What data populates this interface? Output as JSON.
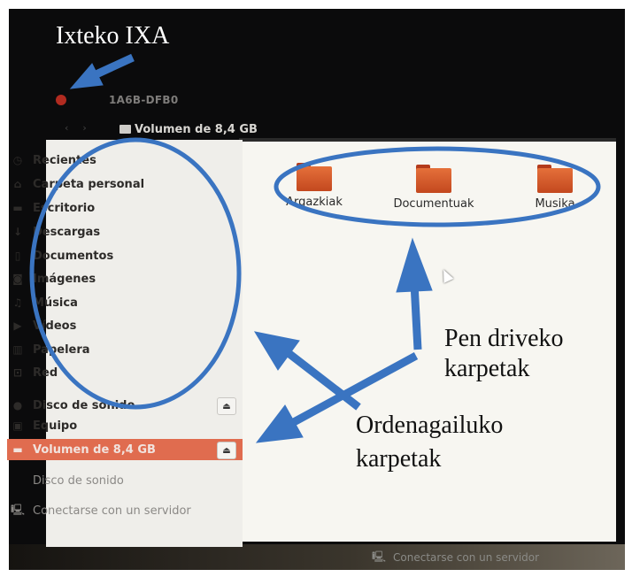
{
  "annotations": {
    "close_hint": "Ixteko IXA",
    "pendrive_label_1": "Pen driveko",
    "pendrive_label_2": "karpetak",
    "computer_label_1": "Ordenagailuko",
    "computer_label_2": "karpetak"
  },
  "window": {
    "title": "1A6B-DFB0",
    "breadcrumb": "Volumen de 8,4 GB"
  },
  "sidebar": {
    "items": [
      {
        "label": "Recientes",
        "icon": "clock-icon"
      },
      {
        "label": "Carpeta personal",
        "icon": "home-icon"
      },
      {
        "label": "Escritorio",
        "icon": "folder-icon"
      },
      {
        "label": "Descargas",
        "icon": "download-icon"
      },
      {
        "label": "Documentos",
        "icon": "document-icon"
      },
      {
        "label": "Imágenes",
        "icon": "camera-icon"
      },
      {
        "label": "Música",
        "icon": "music-icon"
      },
      {
        "label": "Vídeos",
        "icon": "video-icon"
      },
      {
        "label": "Papelera",
        "icon": "trash-icon"
      },
      {
        "label": "Red",
        "icon": "network-icon"
      }
    ],
    "devices": [
      {
        "label": "Disco de sonido",
        "icon": "disc-icon"
      },
      {
        "label": "Equipo",
        "icon": "computer-icon"
      },
      {
        "label": "Volumen de 8,4 GB",
        "icon": "drive-icon"
      }
    ],
    "extra": [
      {
        "label": "Disco de sonido"
      },
      {
        "label": "Conectarse con un servidor",
        "icon": "server-icon"
      }
    ]
  },
  "folders": [
    {
      "label": "Argazkiak"
    },
    {
      "label": "Documentuak"
    },
    {
      "label": "Musika"
    }
  ],
  "background": {
    "connect_server": "Conectarse con un servidor"
  },
  "colors": {
    "annotation_blue": "#3a74c1",
    "selection": "#e06c4f",
    "folder_orange": "#d95a2b",
    "close_red": "#b12b20"
  }
}
